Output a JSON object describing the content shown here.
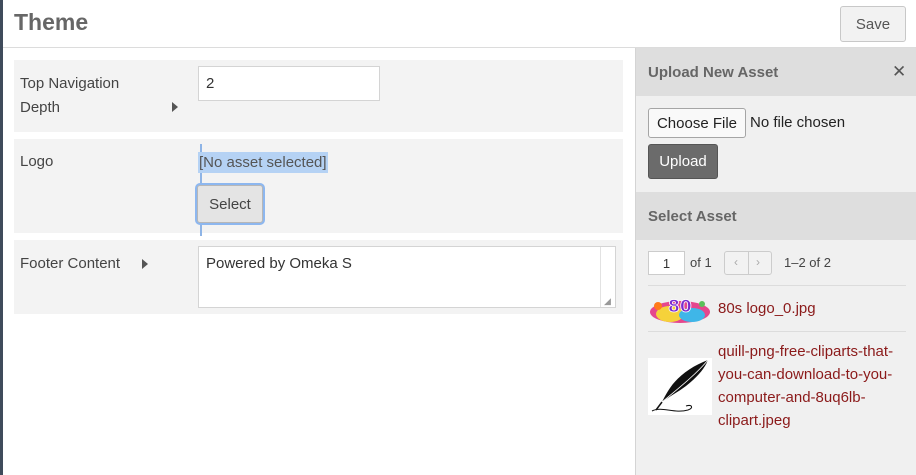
{
  "header": {
    "title": "Theme",
    "save_label": "Save"
  },
  "form": {
    "top_nav": {
      "label": "Top Navigation Depth",
      "value": "2"
    },
    "logo": {
      "label": "Logo",
      "status": "[No asset selected]",
      "select_label": "Select"
    },
    "footer": {
      "label": "Footer Content",
      "value": "Powered by Omeka S"
    }
  },
  "sidebar": {
    "upload_header": "Upload New Asset",
    "choose_file_label": "Choose File",
    "no_file_text": "No file chosen",
    "upload_label": "Upload",
    "select_header": "Select Asset",
    "pagination": {
      "page": "1",
      "of_text": "of 1",
      "range": "1–2 of 2"
    },
    "assets": [
      {
        "name": "80s logo_0.jpg"
      },
      {
        "name": "quill-png-free-cliparts-that-you-can-download-to-you-computer-and-8uq6lb-clipart.jpeg"
      }
    ]
  },
  "colors": {
    "link": "#8b1a1a",
    "selection": "#b5d2f4",
    "upload_button": "#6b6b6b"
  },
  "icons": [
    "caret-right-icon",
    "close-icon",
    "chevron-left-icon",
    "chevron-right-icon",
    "resize-grip-icon"
  ]
}
